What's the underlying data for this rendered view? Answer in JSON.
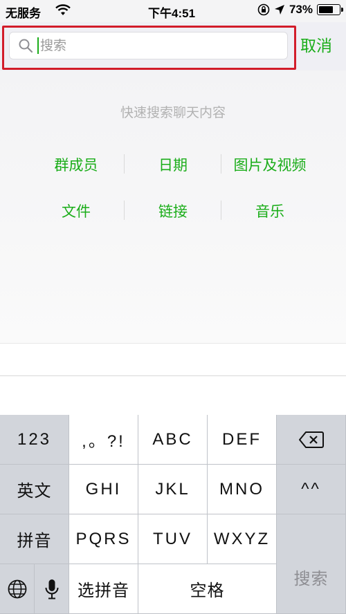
{
  "status_bar": {
    "carrier": "无服务",
    "time": "下午4:51",
    "battery_percent": "73%",
    "battery_level": 0.73
  },
  "search": {
    "placeholder": "搜索",
    "cancel_label": "取消",
    "highlight_color": "#d21c2a",
    "accent_color": "#1aad19"
  },
  "hint": "快速搜索聊天内容",
  "filters": [
    [
      "群成员",
      "日期",
      "图片及视频"
    ],
    [
      "文件",
      "链接",
      "音乐"
    ]
  ],
  "keyboard": {
    "row1": [
      "123",
      ",。?!",
      "ABC",
      "DEF"
    ],
    "row2": [
      "英文",
      "GHI",
      "JKL",
      "MNO",
      "^^"
    ],
    "row3": [
      "拼音",
      "PQRS",
      "TUV",
      "WXYZ"
    ],
    "row4": [
      "选拼音",
      "空格"
    ],
    "search_key": "搜索",
    "icons": [
      "backspace-icon",
      "globe-icon",
      "microphone-icon"
    ]
  }
}
